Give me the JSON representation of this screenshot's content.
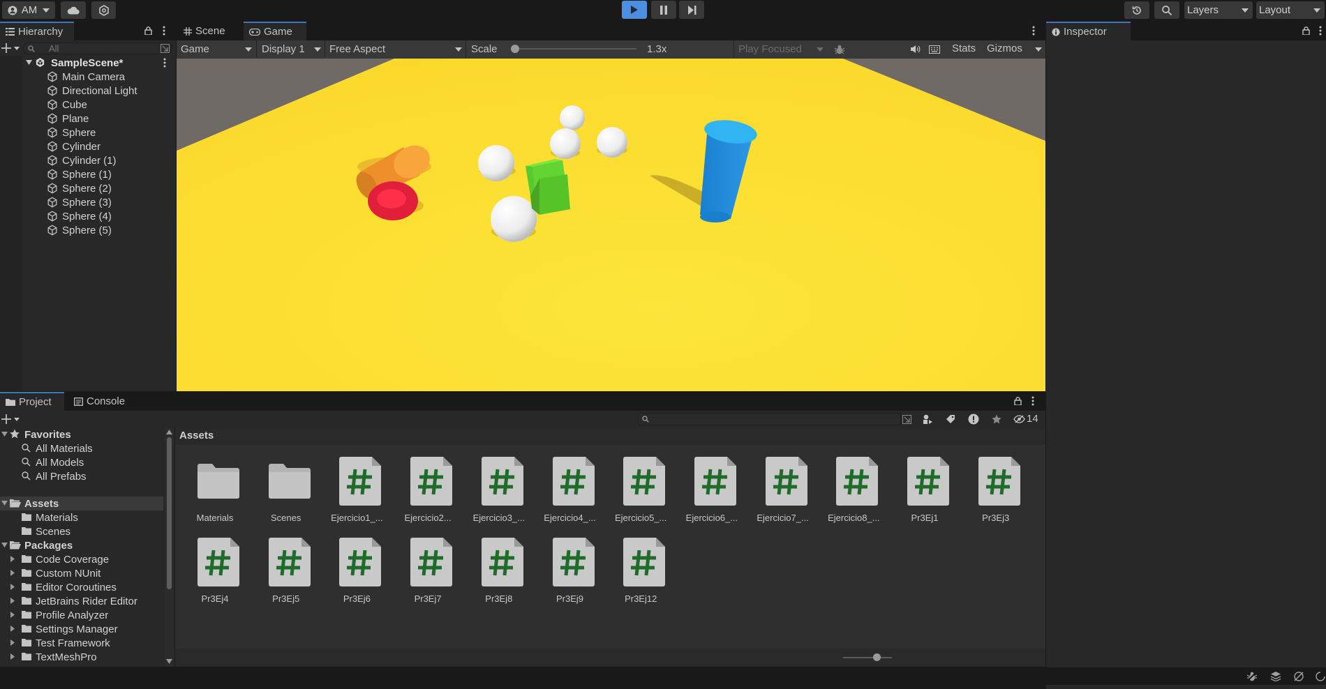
{
  "toolbar": {
    "account_label": "AM",
    "layers_label": "Layers",
    "layout_label": "Layout"
  },
  "hierarchy": {
    "tab_label": "Hierarchy",
    "search_placeholder": "All",
    "scene_name": "SampleScene*",
    "items": [
      "Main Camera",
      "Directional Light",
      "Cube",
      "Plane",
      "Sphere",
      "Cylinder",
      "Cylinder (1)",
      "Sphere (1)",
      "Sphere (2)",
      "Sphere (3)",
      "Sphere (4)",
      "Sphere (5)"
    ]
  },
  "center": {
    "tabs": [
      "Scene",
      "Game"
    ],
    "game_bar": {
      "mode": "Game",
      "display": "Display 1",
      "aspect": "Free Aspect",
      "scale_label": "Scale",
      "scale_value": "1.3x",
      "play_focused": "Play Focused",
      "stats": "Stats",
      "gizmos": "Gizmos"
    }
  },
  "inspector": {
    "tab_label": "Inspector"
  },
  "project": {
    "tabs": [
      "Project",
      "Console"
    ],
    "hidden_count": "14",
    "breadcrumb": "Assets",
    "favorites": {
      "label": "Favorites",
      "items": [
        "All Materials",
        "All Models",
        "All Prefabs"
      ]
    },
    "assets": {
      "label": "Assets",
      "items": [
        "Materials",
        "Scenes"
      ]
    },
    "packages": {
      "label": "Packages",
      "items": [
        "Code Coverage",
        "Custom NUnit",
        "Editor Coroutines",
        "JetBrains Rider Editor",
        "Profile Analyzer",
        "Settings Manager",
        "Test Framework",
        "TextMeshPro"
      ]
    },
    "grid_items": [
      {
        "name": "Materials",
        "type": "folder"
      },
      {
        "name": "Scenes",
        "type": "folder"
      },
      {
        "name": "Ejercicio1_...",
        "type": "script"
      },
      {
        "name": "Ejercicio2...",
        "type": "script"
      },
      {
        "name": "Ejercicio3_...",
        "type": "script"
      },
      {
        "name": "Ejercicio4_...",
        "type": "script"
      },
      {
        "name": "Ejercicio5_...",
        "type": "script"
      },
      {
        "name": "Ejercicio6_...",
        "type": "script"
      },
      {
        "name": "Ejercicio7_...",
        "type": "script"
      },
      {
        "name": "Ejercicio8_...",
        "type": "script"
      },
      {
        "name": "Pr3Ej1",
        "type": "script"
      },
      {
        "name": "Pr3Ej3",
        "type": "script"
      },
      {
        "name": "Pr3Ej4",
        "type": "script"
      },
      {
        "name": "Pr3Ej5",
        "type": "script"
      },
      {
        "name": "Pr3Ej6",
        "type": "script"
      },
      {
        "name": "Pr3Ej7",
        "type": "script"
      },
      {
        "name": "Pr3Ej8",
        "type": "script"
      },
      {
        "name": "Pr3Ej9",
        "type": "script"
      },
      {
        "name": "Pr3Ej12",
        "type": "script"
      }
    ]
  },
  "colors": {
    "accent": "#3a79bb",
    "play_active": "#4c8ee0",
    "plane_yellow": "#fde13a",
    "script_hash": "#1f6b2a"
  }
}
